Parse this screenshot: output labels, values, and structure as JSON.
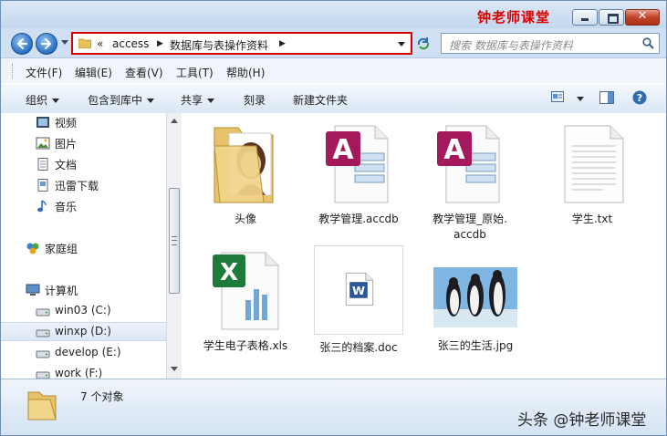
{
  "brand": "钟老师课堂",
  "address": {
    "overflow": "«",
    "segments": [
      "access",
      "数据库与表操作资料"
    ]
  },
  "search": {
    "placeholder": "搜索 数据库与表操作资料"
  },
  "menu": [
    "文件(F)",
    "编辑(E)",
    "查看(V)",
    "工具(T)",
    "帮助(H)"
  ],
  "toolbar": {
    "organize": "组织",
    "include": "包含到库中",
    "share": "共享",
    "burn": "刻录",
    "new_folder": "新建文件夹"
  },
  "sidebar": {
    "libraries": [
      {
        "label": "视频",
        "icon": "video-library-icon"
      },
      {
        "label": "图片",
        "icon": "pictures-library-icon"
      },
      {
        "label": "文档",
        "icon": "documents-library-icon"
      },
      {
        "label": "迅雷下载",
        "icon": "download-library-icon"
      },
      {
        "label": "音乐",
        "icon": "music-library-icon"
      }
    ],
    "homegroup": "家庭组",
    "computer": "计算机",
    "drives": [
      {
        "label": "win03 (C:)",
        "selected": false
      },
      {
        "label": "winxp (D:)",
        "selected": true
      },
      {
        "label": "develop (E:)",
        "selected": false
      },
      {
        "label": "work (F:)",
        "selected": false
      }
    ]
  },
  "files": [
    {
      "name": "头像",
      "type": "folder",
      "icon": "folder-with-portrait-icon"
    },
    {
      "name": "教学管理.accdb",
      "type": "access",
      "icon": "access-database-icon"
    },
    {
      "name": "教学管理_原始.accdb",
      "name_line1": "教学管理_原始.",
      "name_line2": "accdb",
      "type": "access",
      "icon": "access-database-icon"
    },
    {
      "name": "学生.txt",
      "type": "text",
      "icon": "text-document-icon"
    },
    {
      "name": "学生电子表格.xls",
      "type": "excel",
      "icon": "excel-spreadsheet-icon"
    },
    {
      "name": "张三的档案.doc",
      "type": "word",
      "icon": "word-document-icon"
    },
    {
      "name": "张三的生活.jpg",
      "type": "image",
      "icon": "penguins-photo-icon"
    }
  ],
  "status": {
    "count": "7 个对象"
  },
  "watermark": "头条 @钟老师课堂",
  "colors": {
    "highlight": "#d80000",
    "access": "#a4195c",
    "excel": "#1d7a3a",
    "word": "#2b5797"
  }
}
